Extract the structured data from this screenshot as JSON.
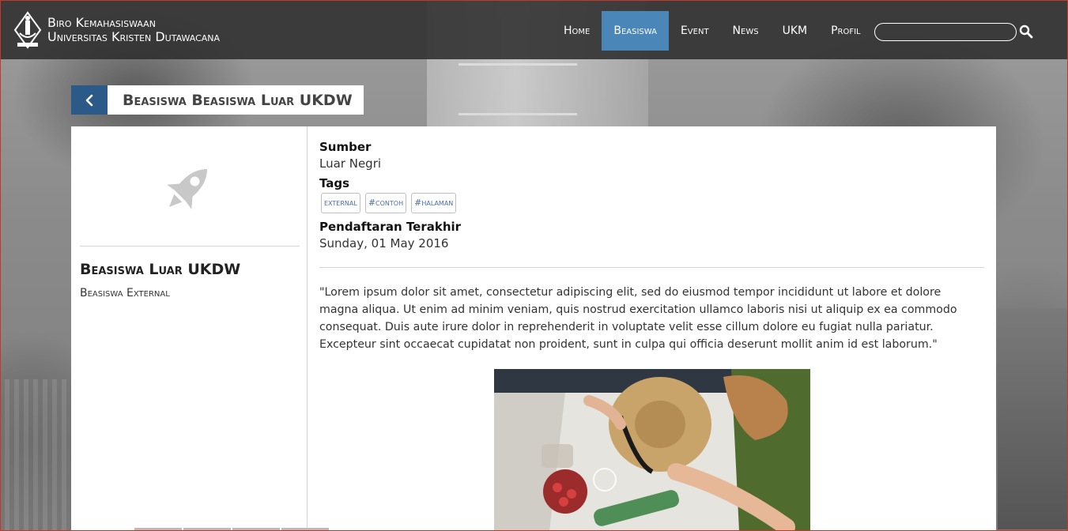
{
  "header": {
    "brand_line1": "Biro Kemahasiswaan",
    "brand_line2": "Universitas Kristen Dutawacana",
    "logo_icon": "ukdw-logo-icon",
    "nav": [
      {
        "label": "Home",
        "active": false
      },
      {
        "label": "Beasiswa",
        "active": true
      },
      {
        "label": "Event",
        "active": false
      },
      {
        "label": "News",
        "active": false
      },
      {
        "label": "UKM",
        "active": false
      },
      {
        "label": "Profil",
        "active": false
      }
    ],
    "search_placeholder": "",
    "search_icon": "search-icon",
    "active_color": "#4a86b8"
  },
  "title_bar": {
    "back_icon": "chevron-left-icon",
    "title": "Beasiswa Beasiswa Luar UKDW",
    "back_color": "#2c5a88"
  },
  "left": {
    "icon": "rocket-icon",
    "title": "Beasiswa Luar UKDW",
    "subtitle": "Beasiswa External"
  },
  "detail": {
    "sumber_label": "Sumber",
    "sumber_value": "Luar Negri",
    "tags_label": "Tags",
    "tags": [
      "external",
      "#contoh",
      "#halaman"
    ],
    "deadline_label": "Pendaftaran Terakhir",
    "deadline_value": "Sunday, 01 May 2016",
    "description": "\"Lorem ipsum dolor sit amet, consectetur adipiscing elit, sed do eiusmod tempor incididunt ut labore et dolore magna aliqua. Ut enim ad minim veniam, quis nostrud exercitation ullamco laboris nisi ut aliquip ex ea commodo consequat. Duis aute irure dolor in reprehenderit in voluptate velit esse cillum dolore eu fugiat nulla pariatur. Excepteur sint occaecat cupidatat non proident, sunt in culpa qui officia deserunt mollit anim id est laborum.\""
  }
}
